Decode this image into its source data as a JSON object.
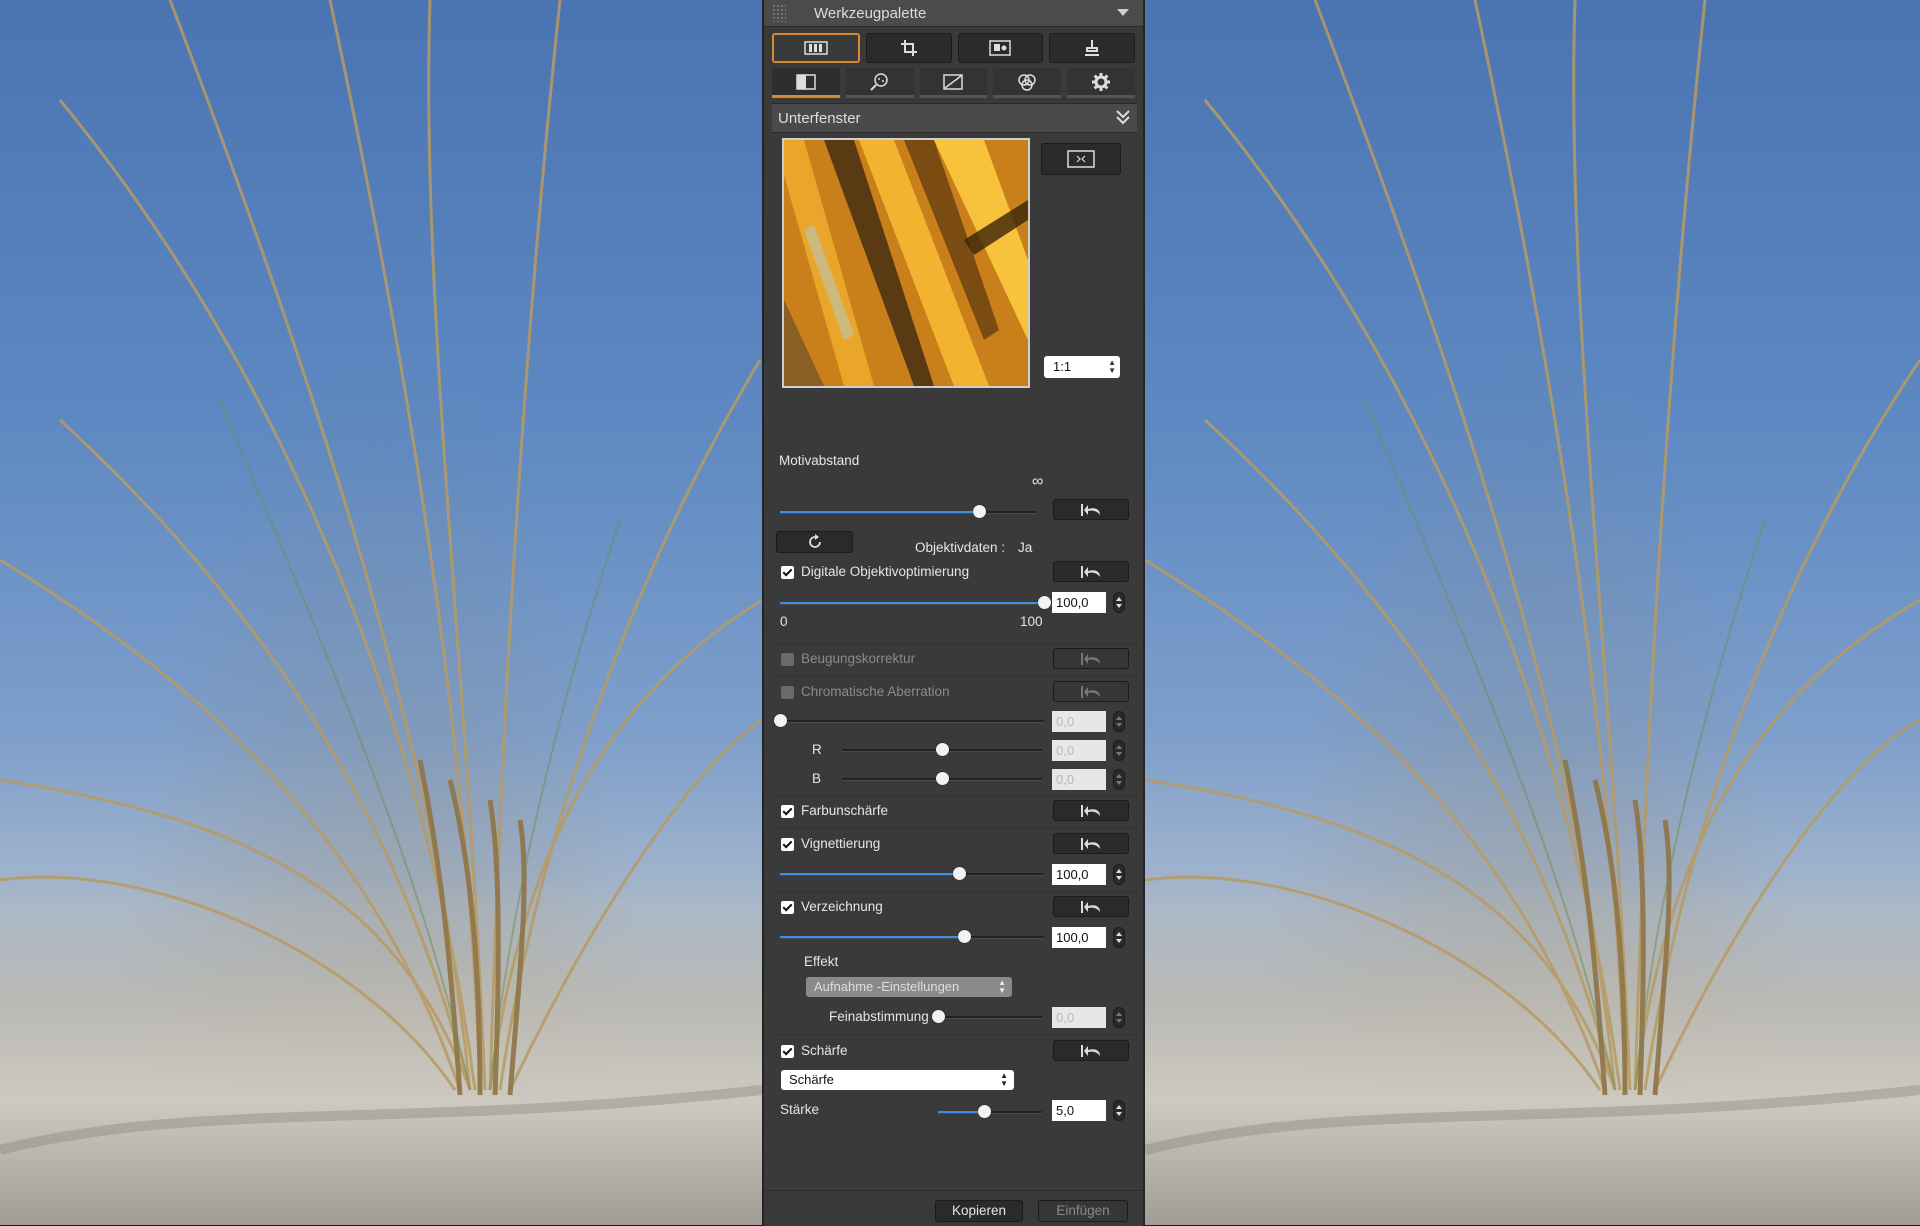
{
  "palette": {
    "title": "Werkzeugpalette",
    "section_title": "Unterfenster",
    "zoom_value": "1:1",
    "motif_distance": {
      "label": "Motivabstand",
      "infinity_symbol": "∞",
      "value": 0.78
    },
    "lens_data": {
      "label": "Objektivdaten :",
      "value": "Ja"
    },
    "digital_lens_opt": {
      "label": "Digitale Objektivoptimierung",
      "checked": true,
      "value": "100,0",
      "min_label": "0",
      "max_label": "100"
    },
    "diffraction": {
      "label": "Beugungskorrektur",
      "checked": false,
      "enabled": false
    },
    "chromatic": {
      "label": "Chromatische Aberration",
      "checked": false,
      "enabled": false,
      "value": "0,0",
      "r_label": "R",
      "r_value": "0,0",
      "b_label": "B",
      "b_value": "0,0"
    },
    "color_blur": {
      "label": "Farbunschärfe",
      "checked": true
    },
    "vignetting": {
      "label": "Vignettierung",
      "checked": true,
      "value": "100,0"
    },
    "distortion": {
      "label": "Verzeichnung",
      "checked": true,
      "value": "100,0",
      "effect_label": "Effekt",
      "effect_value": "Aufnahme -Einstellungen",
      "fine_label": "Feinabstimmung",
      "fine_value": "0,0"
    },
    "sharpness": {
      "label": "Schärfe",
      "checked": true,
      "mode": "Schärfe",
      "strength_label": "Stärke",
      "strength_value": "5,0"
    },
    "buttons": {
      "copy": "Kopieren",
      "paste": "Einfügen"
    }
  },
  "colors": {
    "accent": "#d98a2c",
    "slider_blue": "#3d8fe6",
    "panel": "#3a3a3a"
  }
}
